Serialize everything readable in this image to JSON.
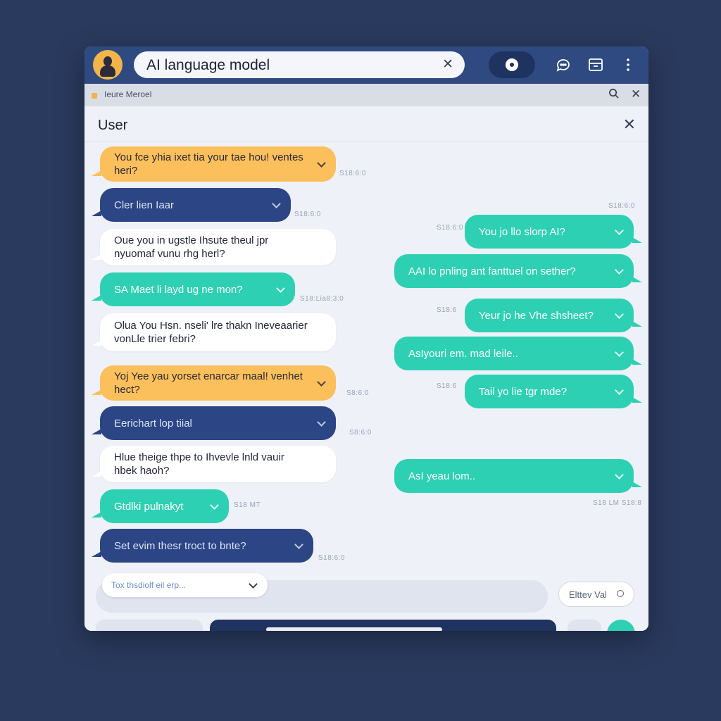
{
  "colors": {
    "background": "#2a3a5e",
    "topbar": "#2e4a80",
    "orange_bubble": "#fbbf5c",
    "navy_bubble": "#2b4585",
    "white_bubble": "#ffffff",
    "teal_bubble": "#2ed0b3"
  },
  "header": {
    "avatar_icon": "user-avatar",
    "search_text": "AI language model",
    "clear_icon": "close-icon",
    "toggle_icon": "record-icon",
    "icons": [
      "chat-bubble-icon",
      "window-icon",
      "more-vertical-icon"
    ]
  },
  "subbar": {
    "label": "Ieure Merоel",
    "icons": [
      "search-icon",
      "close-icon"
    ]
  },
  "panel": {
    "title": "User",
    "close_icon": "close-icon"
  },
  "messages_left": [
    {
      "style": "orange",
      "text": "You fce yhia ixet tia your tae hou! ventes heri?",
      "time": "S18:6:0"
    },
    {
      "style": "navy",
      "text": "Cler lien Iaar",
      "time": "S18:6:0"
    },
    {
      "style": "white",
      "text": "Oue you in ugstle Ihsute theul jpr nyuomaf vunu rhg herl?",
      "time": ""
    },
    {
      "style": "teal",
      "text": "SA Maet li layd ug ne mon?",
      "time": "S18:Lia8:3:0"
    },
    {
      "style": "white",
      "text": "Olua You Hsn. nseli' lre thakn Ineveaarier vonLle trier febri?",
      "time": ""
    },
    {
      "style": "orange",
      "text": "Yoj Yee yau yorset enarcar maal! venhet hect?",
      "time": "S8:6:0"
    },
    {
      "style": "navy",
      "text": "Eerichart lop tiial",
      "time": "S8:6:0"
    },
    {
      "style": "white",
      "text": "Hlue theige thpe to Ihvevle lnld vauir hbek haoh?",
      "time": ""
    },
    {
      "style": "teal",
      "text": "Gtdlki pulnakyt",
      "time": "S18 MT"
    },
    {
      "style": "navy",
      "text": "Set evim thesr troct to bnte?",
      "time": "S18:6:0"
    }
  ],
  "messages_right": [
    {
      "style": "teal",
      "text": "You jo llo slorp AI?",
      "time": "S18:6:0"
    },
    {
      "style": "teal",
      "text": "AAI lo pnling ant fanttuel on sether?",
      "time": ""
    },
    {
      "style": "teal",
      "text": "Yeur jo he Vhe shsheet?",
      "time": "S18:6"
    },
    {
      "style": "teal",
      "text": "AsIyouri em. mad leile..",
      "time": ""
    },
    {
      "style": "teal",
      "text": "Tail yo lie tgr mde?",
      "time": "S18:6"
    },
    {
      "style": "teal",
      "text": "AsI yeau lom..",
      "time": "S18 LM S18:8"
    }
  ],
  "extra_timestamps": [
    "S18:6:0"
  ],
  "composer": {
    "placeholder": "Tox thsdiolf eil erp...",
    "send_label": "Elttev Val"
  }
}
